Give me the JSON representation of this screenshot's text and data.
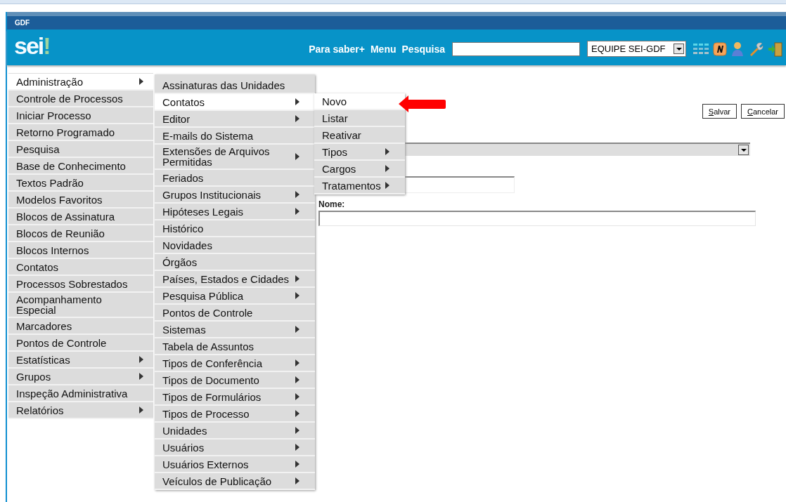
{
  "org_bar": {
    "title": "GDF"
  },
  "header": {
    "logo": "sei",
    "logo_mark": "!",
    "links": [
      "Para saber+",
      "Menu",
      "Pesquisa"
    ],
    "unit": "EQUIPE SEI-GDF"
  },
  "main_menu": [
    {
      "label": "Administração",
      "submenu": true,
      "selected": true
    },
    {
      "label": "Controle de Processos",
      "submenu": false,
      "selected": false
    },
    {
      "label": "Iniciar Processo",
      "submenu": false,
      "selected": false
    },
    {
      "label": "Retorno Programado",
      "submenu": false,
      "selected": false
    },
    {
      "label": "Pesquisa",
      "submenu": false,
      "selected": false
    },
    {
      "label": "Base de Conhecimento",
      "submenu": false,
      "selected": false
    },
    {
      "label": "Textos Padrão",
      "submenu": false,
      "selected": false
    },
    {
      "label": "Modelos Favoritos",
      "submenu": false,
      "selected": false
    },
    {
      "label": "Blocos de Assinatura",
      "submenu": false,
      "selected": false
    },
    {
      "label": "Blocos de Reunião",
      "submenu": false,
      "selected": false
    },
    {
      "label": "Blocos Internos",
      "submenu": false,
      "selected": false
    },
    {
      "label": "Contatos",
      "submenu": false,
      "selected": false
    },
    {
      "label": "Processos Sobrestados",
      "submenu": false,
      "selected": false
    },
    {
      "label": "Acompanhamento Especial",
      "submenu": false,
      "selected": false
    },
    {
      "label": "Marcadores",
      "submenu": false,
      "selected": false
    },
    {
      "label": "Pontos de Controle",
      "submenu": false,
      "selected": false
    },
    {
      "label": "Estatísticas",
      "submenu": true,
      "selected": false
    },
    {
      "label": "Grupos",
      "submenu": true,
      "selected": false
    },
    {
      "label": "Inspeção Administrativa",
      "submenu": false,
      "selected": false
    },
    {
      "label": "Relatórios",
      "submenu": true,
      "selected": false
    }
  ],
  "admin_menu": [
    {
      "label": "Assinaturas das Unidades",
      "submenu": false,
      "selected": false
    },
    {
      "label": "Contatos",
      "submenu": true,
      "selected": true
    },
    {
      "label": "Editor",
      "submenu": true,
      "selected": false
    },
    {
      "label": "E-mails do Sistema",
      "submenu": false,
      "selected": false
    },
    {
      "label": "Extensões de Arquivos Permitidas",
      "submenu": true,
      "selected": false
    },
    {
      "label": "Feriados",
      "submenu": false,
      "selected": false
    },
    {
      "label": "Grupos Institucionais",
      "submenu": true,
      "selected": false
    },
    {
      "label": "Hipóteses Legais",
      "submenu": true,
      "selected": false
    },
    {
      "label": "Histórico",
      "submenu": false,
      "selected": false
    },
    {
      "label": "Novidades",
      "submenu": false,
      "selected": false
    },
    {
      "label": "Órgãos",
      "submenu": false,
      "selected": false
    },
    {
      "label": "Países, Estados e Cidades",
      "submenu": true,
      "selected": false
    },
    {
      "label": "Pesquisa Pública",
      "submenu": true,
      "selected": false
    },
    {
      "label": "Pontos de Controle",
      "submenu": false,
      "selected": false
    },
    {
      "label": "Sistemas",
      "submenu": true,
      "selected": false
    },
    {
      "label": "Tabela de Assuntos",
      "submenu": false,
      "selected": false
    },
    {
      "label": "Tipos de Conferência",
      "submenu": true,
      "selected": false
    },
    {
      "label": "Tipos de Documento",
      "submenu": true,
      "selected": false
    },
    {
      "label": "Tipos de Formulários",
      "submenu": true,
      "selected": false
    },
    {
      "label": "Tipos de Processo",
      "submenu": true,
      "selected": false
    },
    {
      "label": "Unidades",
      "submenu": true,
      "selected": false
    },
    {
      "label": "Usuários",
      "submenu": true,
      "selected": false
    },
    {
      "label": "Usuários Externos",
      "submenu": true,
      "selected": false
    },
    {
      "label": "Veículos de Publicação",
      "submenu": true,
      "selected": false
    }
  ],
  "contacts_menu": [
    {
      "label": "Novo",
      "submenu": false,
      "selected": true
    },
    {
      "label": "Listar",
      "submenu": false,
      "selected": false
    },
    {
      "label": "Reativar",
      "submenu": false,
      "selected": false
    },
    {
      "label": "Tipos",
      "submenu": true,
      "selected": false
    },
    {
      "label": "Cargos",
      "submenu": true,
      "selected": false
    },
    {
      "label": "Tratamentos",
      "submenu": true,
      "selected": false
    }
  ],
  "form": {
    "buttons": [
      {
        "label": "Salvar"
      },
      {
        "label": "Cancelar"
      }
    ],
    "name_label": "Nome:"
  }
}
